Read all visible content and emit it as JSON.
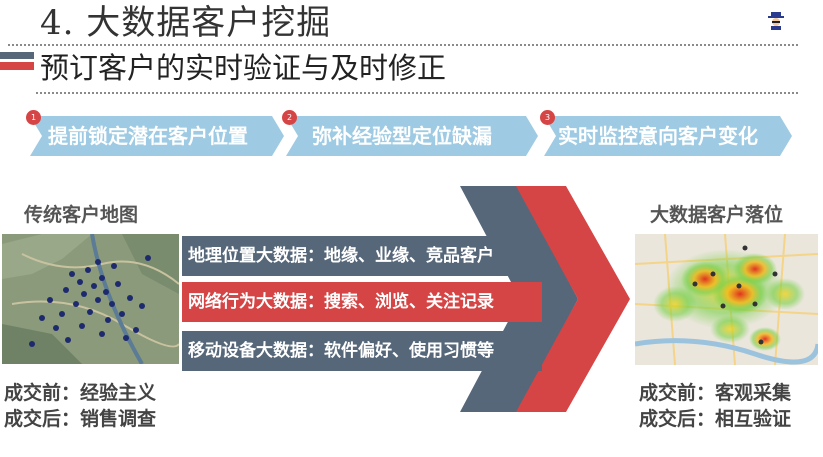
{
  "header": {
    "title": "4.  大数据客户挖掘",
    "subtitle": "预订客户的实时验证与及时修正"
  },
  "steps": [
    {
      "num": "1",
      "label": "提前锁定潜在客户位置"
    },
    {
      "num": "2",
      "label": "弥补经验型定位缺漏"
    },
    {
      "num": "3",
      "label": "实时监控意向客户变化"
    }
  ],
  "left": {
    "label": "传统客户地图",
    "notes": [
      "成交前：经验主义",
      "成交后：销售调查"
    ]
  },
  "right": {
    "label": "大数据客户落位",
    "notes": [
      "成交前：客观采集",
      "成交后：相互验证"
    ]
  },
  "bands": [
    {
      "text": "地理位置大数据：地缘、业缘、竞品客户",
      "color": "#56677a"
    },
    {
      "text": "网络行为大数据：搜索、浏览、关注记录",
      "color": "#d64545"
    },
    {
      "text": "移动设备大数据：软件偏好、使用习惯等",
      "color": "#56677a"
    }
  ],
  "colors": {
    "accent_red": "#d64545",
    "slate": "#56677a",
    "step_blue": "#9ecbe3"
  },
  "icons": {
    "logo": "detective-logo-icon"
  }
}
